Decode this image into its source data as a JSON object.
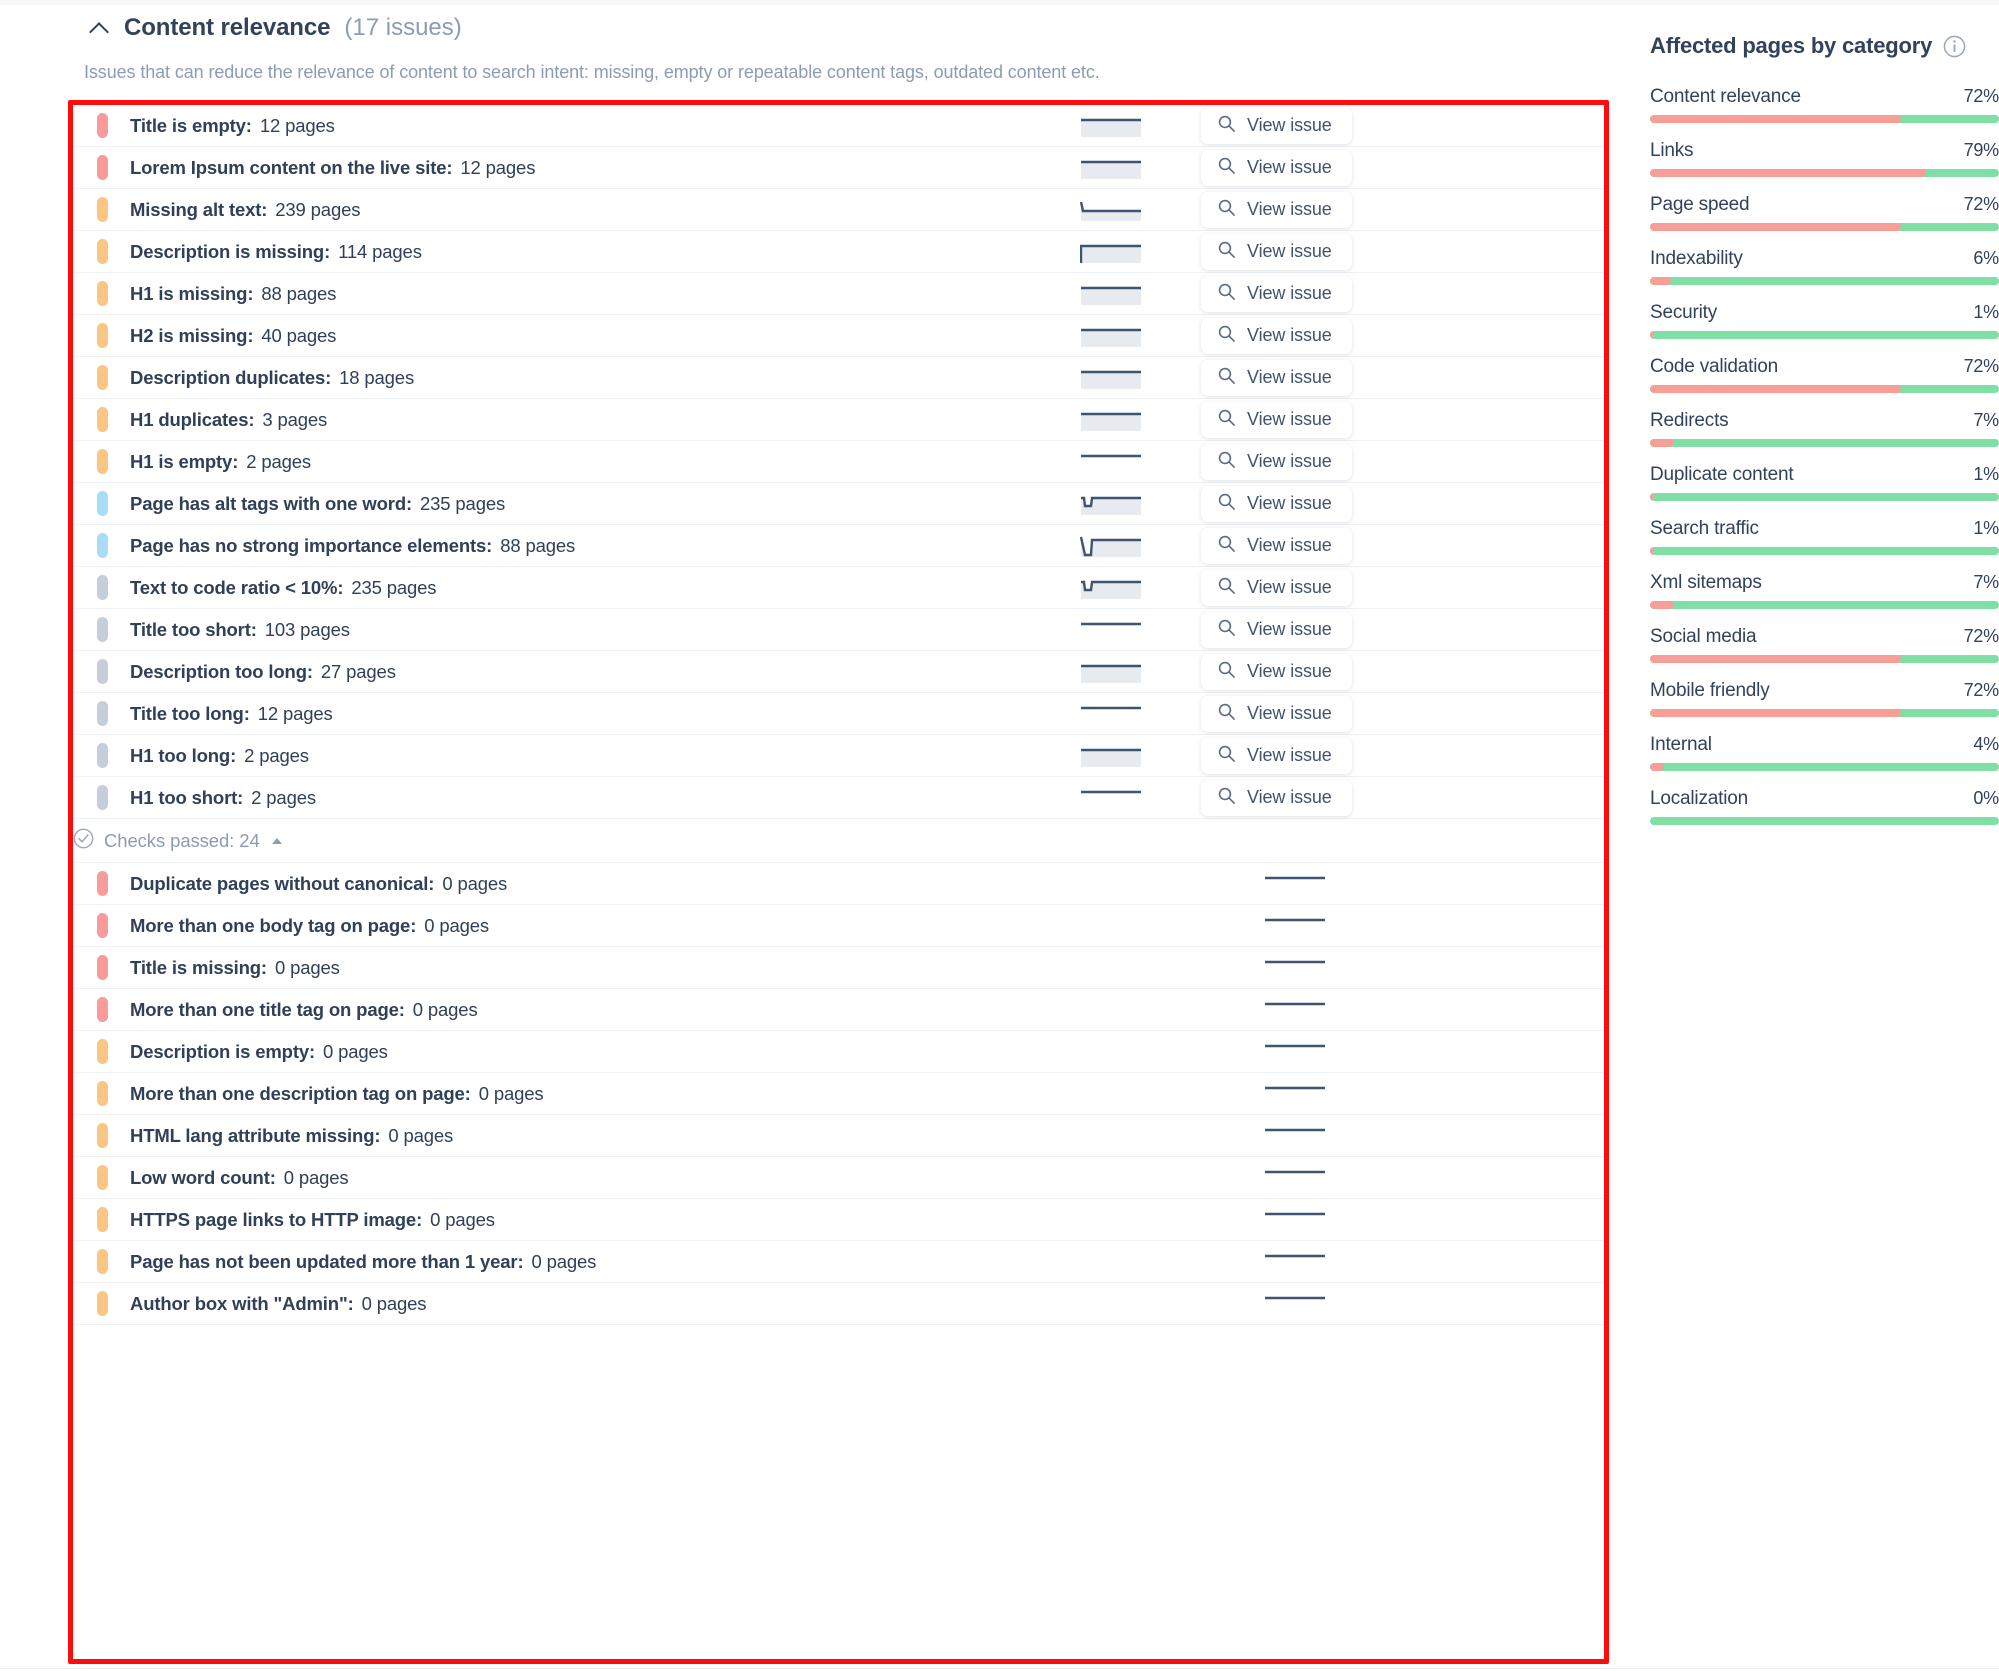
{
  "section": {
    "title": "Content relevance",
    "count_label": "(17 issues)",
    "description": "Issues that can reduce the relevance of content to search intent: missing, empty or repeatable content tags, outdated content etc.",
    "collapse_icon": "chevron-up-icon"
  },
  "buttons": {
    "view_issue": "View issue",
    "search_icon": "magnifier-icon"
  },
  "checks_passed": {
    "label": "Checks passed: 24",
    "icon": "check-circle-icon"
  },
  "issues": [
    {
      "name": "Title is empty",
      "pages": "12 pages",
      "severity": "critical",
      "spark": "flat",
      "action": "View issue"
    },
    {
      "name": "Lorem Ipsum content on the live site",
      "pages": "12 pages",
      "severity": "critical",
      "spark": "flat",
      "action": "View issue"
    },
    {
      "name": "Missing alt text",
      "pages": "239 pages",
      "severity": "warning",
      "spark": "drop-start",
      "action": "View issue"
    },
    {
      "name": "Description is missing",
      "pages": "114 pages",
      "severity": "warning",
      "spark": "rise-start",
      "action": "View issue"
    },
    {
      "name": "H1 is missing",
      "pages": "88 pages",
      "severity": "warning",
      "spark": "flat",
      "action": "View issue"
    },
    {
      "name": "H2 is missing",
      "pages": "40 pages",
      "severity": "warning",
      "spark": "flat",
      "action": "View issue"
    },
    {
      "name": "Description duplicates",
      "pages": "18 pages",
      "severity": "warning",
      "spark": "flat",
      "action": "View issue"
    },
    {
      "name": "H1 duplicates",
      "pages": "3 pages",
      "severity": "warning",
      "spark": "flat",
      "action": "View issue"
    },
    {
      "name": "H1 is empty",
      "pages": "2 pages",
      "severity": "warning",
      "spark": "line",
      "action": "View issue"
    },
    {
      "name": "Page has alt tags with one word",
      "pages": "235 pages",
      "severity": "notice",
      "spark": "dip",
      "action": "View issue"
    },
    {
      "name": "Page has no strong importance elements",
      "pages": "88 pages",
      "severity": "notice",
      "spark": "deep-dip",
      "action": "View issue"
    },
    {
      "name": "Text to code ratio < 10%",
      "pages": "235 pages",
      "severity": "info",
      "spark": "dip",
      "action": "View issue"
    },
    {
      "name": "Title too short",
      "pages": "103 pages",
      "severity": "info",
      "spark": "line",
      "action": "View issue"
    },
    {
      "name": "Description too long",
      "pages": "27 pages",
      "severity": "info",
      "spark": "flat",
      "action": "View issue"
    },
    {
      "name": "Title too long",
      "pages": "12 pages",
      "severity": "info",
      "spark": "line",
      "action": "View issue"
    },
    {
      "name": "H1 too long",
      "pages": "2 pages",
      "severity": "info",
      "spark": "flat",
      "action": "View issue"
    },
    {
      "name": "H1 too short",
      "pages": "2 pages",
      "severity": "info",
      "spark": "line",
      "action": "View issue"
    }
  ],
  "passed_issues": [
    {
      "name": "Duplicate pages without canonical",
      "pages": "0 pages",
      "severity": "critical",
      "spark": "line"
    },
    {
      "name": "More than one body tag on page",
      "pages": "0 pages",
      "severity": "critical",
      "spark": "line"
    },
    {
      "name": "Title is missing",
      "pages": "0 pages",
      "severity": "critical",
      "spark": "line"
    },
    {
      "name": "More than one title tag on page",
      "pages": "0 pages",
      "severity": "critical",
      "spark": "line"
    },
    {
      "name": "Description is empty",
      "pages": "0 pages",
      "severity": "warning",
      "spark": "line"
    },
    {
      "name": "More than one description tag on page",
      "pages": "0 pages",
      "severity": "warning",
      "spark": "line"
    },
    {
      "name": "HTML lang attribute missing",
      "pages": "0 pages",
      "severity": "warning",
      "spark": "line"
    },
    {
      "name": "Low word count",
      "pages": "0 pages",
      "severity": "warning",
      "spark": "line"
    },
    {
      "name": "HTTPS page links to HTTP image",
      "pages": "0 pages",
      "severity": "warning",
      "spark": "line"
    },
    {
      "name": "Page has not been updated more than 1 year",
      "pages": "0 pages",
      "severity": "warning",
      "spark": "line"
    },
    {
      "name": "Author box with \"Admin\"",
      "pages": "0 pages",
      "severity": "warning",
      "spark": "line"
    }
  ],
  "sidebar": {
    "title": "Affected pages by category",
    "info_icon": "info-icon",
    "colors": {
      "affected": "#f79e96",
      "healthy": "#7fdfa4"
    },
    "categories": [
      {
        "name": "Content relevance",
        "percent": "72%",
        "value": 72
      },
      {
        "name": "Links",
        "percent": "79%",
        "value": 79
      },
      {
        "name": "Page speed",
        "percent": "72%",
        "value": 72
      },
      {
        "name": "Indexability",
        "percent": "6%",
        "value": 6
      },
      {
        "name": "Security",
        "percent": "1%",
        "value": 1
      },
      {
        "name": "Code validation",
        "percent": "72%",
        "value": 72
      },
      {
        "name": "Redirects",
        "percent": "7%",
        "value": 7
      },
      {
        "name": "Duplicate content",
        "percent": "1%",
        "value": 1
      },
      {
        "name": "Search traffic",
        "percent": "1%",
        "value": 1
      },
      {
        "name": "Xml sitemaps",
        "percent": "7%",
        "value": 7
      },
      {
        "name": "Social media",
        "percent": "72%",
        "value": 72
      },
      {
        "name": "Mobile friendly",
        "percent": "72%",
        "value": 72
      },
      {
        "name": "Internal",
        "percent": "4%",
        "value": 4
      },
      {
        "name": "Localization",
        "percent": "0%",
        "value": 0
      }
    ]
  },
  "annotation": {
    "highlight_color": "#fb0d0d"
  }
}
